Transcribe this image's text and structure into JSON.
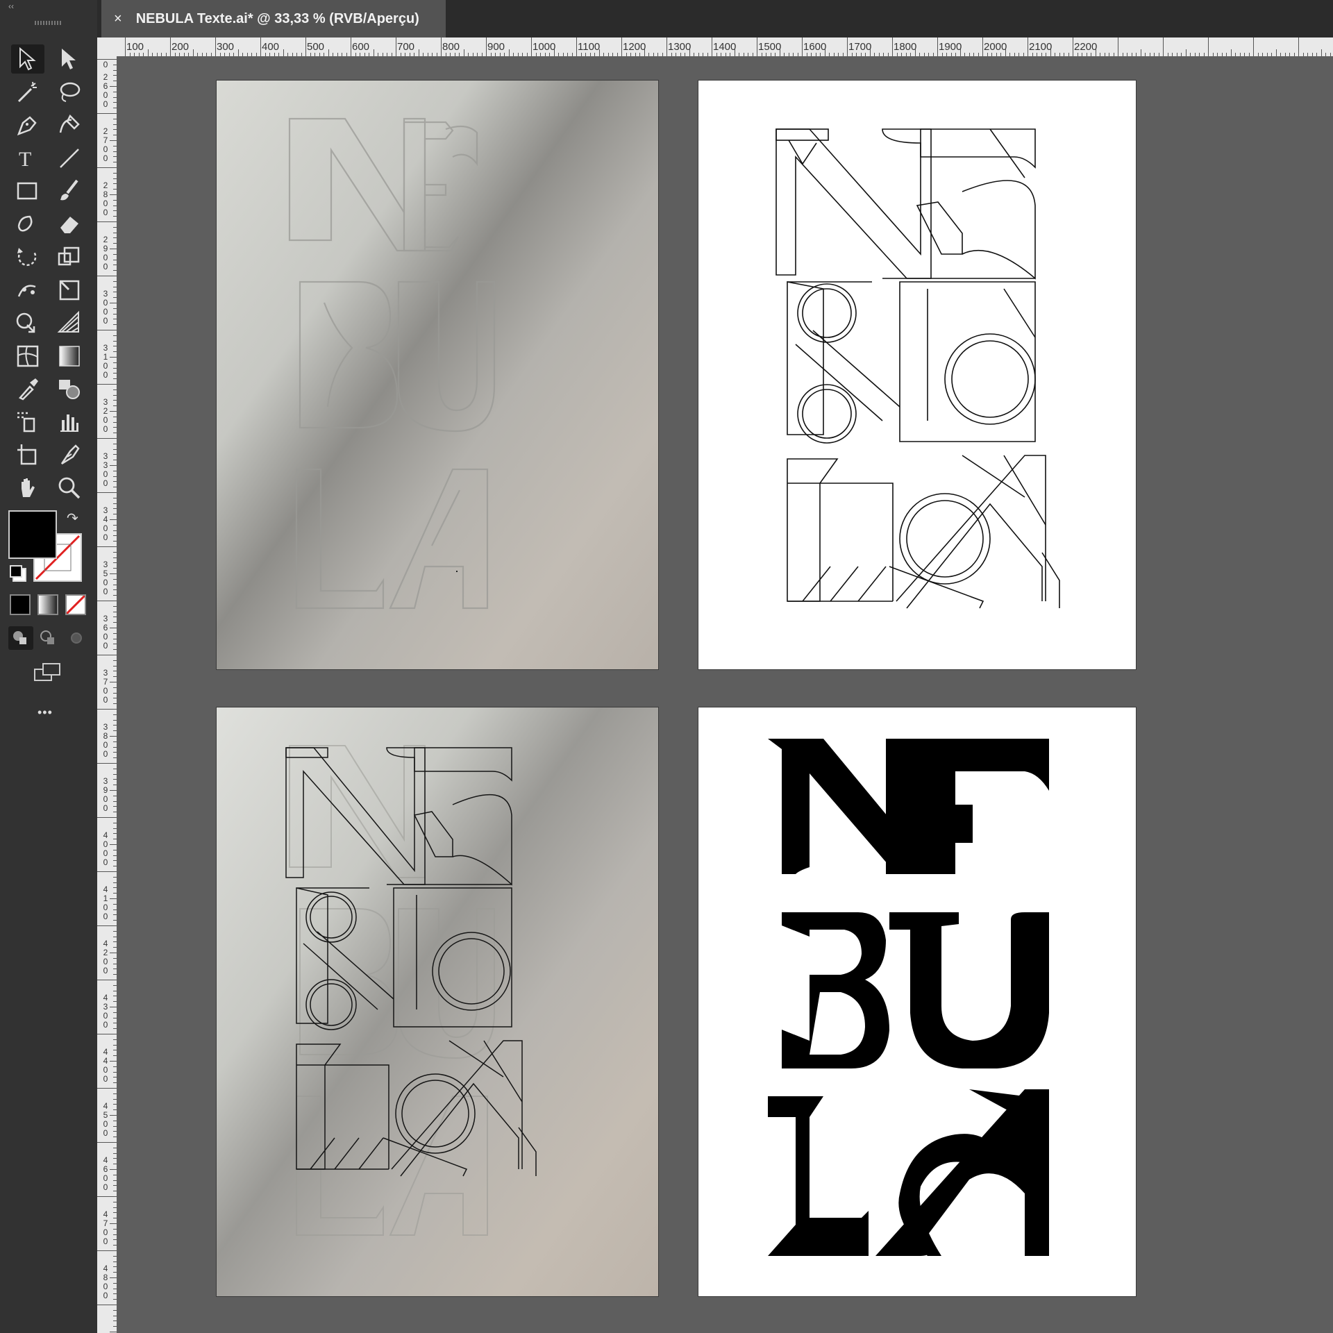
{
  "document_tab": {
    "title": "NEBULA Texte.ai* @ 33,33 % (RVB/Aperçu)",
    "close_glyph": "×"
  },
  "toolbar": {
    "collapse_glyph": "‹‹",
    "tools": [
      "selection-tool",
      "direct-selection-tool",
      "magic-wand-tool",
      "lasso-tool",
      "pen-tool",
      "curvature-tool",
      "type-tool",
      "line-segment-tool",
      "rectangle-tool",
      "paintbrush-tool",
      "shaper-tool",
      "eraser-tool",
      "rotate-tool",
      "scale-tool",
      "puppet-warp-tool",
      "free-transform-tool",
      "shape-builder-tool",
      "perspective-grid-tool",
      "mesh-tool",
      "gradient-tool",
      "eyedropper-tool",
      "blend-tool",
      "symbol-sprayer-tool",
      "column-graph-tool",
      "artboard-tool",
      "slice-tool",
      "hand-tool",
      "zoom-tool"
    ],
    "fill_color": "#000000",
    "stroke": "none",
    "more_tools_glyph": "•••"
  },
  "ruler_top": [
    "100",
    "200",
    "300",
    "400",
    "500",
    "600",
    "700",
    "800",
    "900",
    "1000",
    "1100",
    "1200",
    "1300",
    "1400",
    "1500",
    "1600",
    "1700",
    "1800",
    "1900",
    "2000",
    "2100",
    "2200"
  ],
  "ruler_left": [
    "0",
    "2600",
    "2700",
    "2800",
    "2900",
    "3000",
    "3100",
    "3200",
    "3300",
    "3400",
    "3500",
    "3600",
    "3700",
    "3800",
    "3900",
    "4000",
    "4100",
    "4200",
    "4300",
    "4400",
    "4500",
    "4600",
    "4700",
    "4800"
  ],
  "artboards": [
    {
      "name": "pencil-sketch-photo",
      "word": "NEBULA"
    },
    {
      "name": "outline-vector",
      "word": "NEBULA"
    },
    {
      "name": "overlay-sketch-outline",
      "word": "NEBULA"
    },
    {
      "name": "final-black-lettering",
      "word": "NEBULA"
    }
  ],
  "colors": {
    "ui_dark": "#323232",
    "canvas": "#5e5e5e",
    "accent_none": "#e02020"
  }
}
